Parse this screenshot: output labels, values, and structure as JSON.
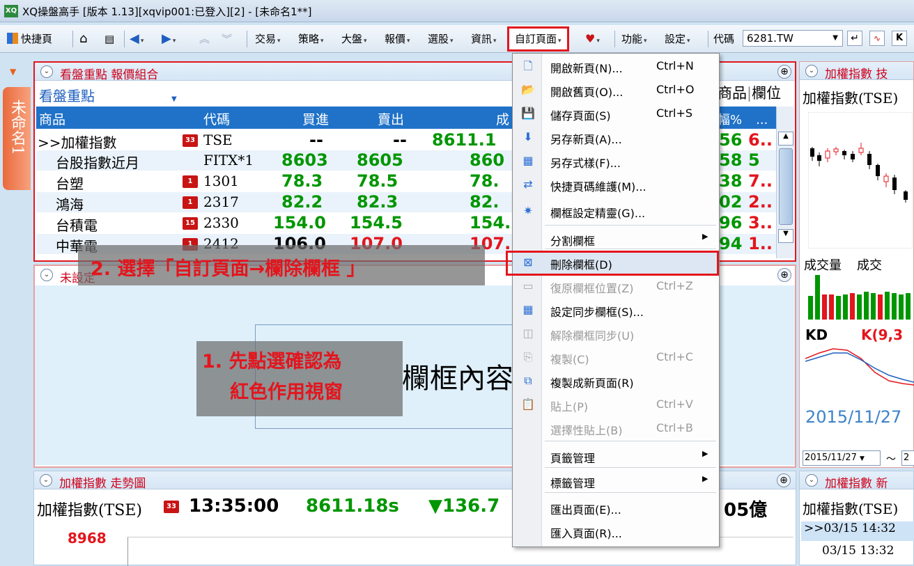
{
  "window": {
    "title": "XQ操盤高手 [版本 1.13][xqvip001:已登入][2] - [未命名1**]",
    "icon_text": "XQ"
  },
  "toolbar": {
    "quick_page": "快捷頁",
    "menus": [
      "交易",
      "策略",
      "大盤",
      "報價",
      "選股",
      "資訊"
    ],
    "custom_page": "自訂頁面",
    "function": "功能",
    "settings": "設定",
    "code_label": "代碼",
    "code_value": "6281.TW"
  },
  "side_tab": {
    "label": "未命名1"
  },
  "panel_quote": {
    "title": "看盤重點 報價組合",
    "group": "看盤重點",
    "headers": [
      "商品",
      "代碼",
      "買進",
      "賣出",
      "成"
    ],
    "rows": [
      {
        "name": ">>加權指數",
        "badge": "33",
        "code": "TSE",
        "bid": "--",
        "ask": "--",
        "last": "8611.1"
      },
      {
        "name": "台股指數近月",
        "badge": "",
        "code": "FITX*1",
        "bid": "8603",
        "ask": "8605",
        "last": "860"
      },
      {
        "name": "台塑",
        "badge": "1",
        "code": "1301",
        "bid": "78.3",
        "ask": "78.5",
        "last": "78."
      },
      {
        "name": "鴻海",
        "badge": "1",
        "code": "2317",
        "bid": "82.2",
        "ask": "82.3",
        "last": "82."
      },
      {
        "name": "台積電",
        "badge": "15",
        "code": "2330",
        "bid": "154.0",
        "ask": "154.5",
        "last": "154."
      },
      {
        "name": "中華電",
        "badge": "1",
        "code": "2412",
        "bid": "106.0",
        "ask": "107.0",
        "last": "107."
      }
    ],
    "right_headers": [
      "商品",
      "欄位"
    ],
    "right_sub": "幅%",
    "right_sub2": "...",
    "right_vals": [
      {
        "a": "56",
        "b": "6.."
      },
      {
        "a": "58",
        "b": "5"
      },
      {
        "a": "38",
        "b": "7.."
      },
      {
        "a": "02",
        "b": "2.."
      },
      {
        "a": "96",
        "b": "3.."
      },
      {
        "a": "94",
        "b": "1.."
      }
    ]
  },
  "panel_unset": {
    "title": "未設定",
    "content": "欄框內容"
  },
  "panel_trend": {
    "title": "加權指數 走勢圖",
    "name": "加權指數(TSE)",
    "badge": "33",
    "time": "13:35:00",
    "price": "8611.18s",
    "change": "▼136.7",
    "volume_tail": "05億",
    "y_label": "8968"
  },
  "panel_tech": {
    "title": "加權指數 技",
    "name": "加權指數(TSE)",
    "vol_label": "成交量",
    "vol_label2": "成交",
    "kd_label": "KD",
    "kd_value": "K(9,3",
    "date": "2015/11/27",
    "date_sel": "2015/11/27",
    "date_tilde": "～",
    "date_sel2": "2"
  },
  "panel_news": {
    "title": "加權指數 新",
    "name": "加權指數(TSE)",
    "items": [
      ">>03/15 14:32",
      "03/15 13:32"
    ]
  },
  "menu": {
    "items": [
      {
        "icon": "new-page-icon",
        "label": "開啟新頁(N)...",
        "shortcut": "Ctrl+N",
        "enabled": true
      },
      {
        "icon": "open-folder-icon",
        "label": "開啟舊頁(O)...",
        "shortcut": "Ctrl+O",
        "enabled": true
      },
      {
        "icon": "save-icon",
        "label": "儲存頁面(S)",
        "shortcut": "Ctrl+S",
        "enabled": true
      },
      {
        "icon": "save-new-icon",
        "label": "另存新頁(A)...",
        "shortcut": "",
        "enabled": true
      },
      {
        "icon": "save-style-icon",
        "label": "另存式樣(F)...",
        "shortcut": "",
        "enabled": true
      },
      {
        "icon": "shortcut-maintain-icon",
        "label": "快捷頁碼維護(M)...",
        "shortcut": "",
        "enabled": true
      },
      {
        "icon": "wizard-icon",
        "label": "欄框設定精靈(G)...",
        "shortcut": "",
        "enabled": true
      },
      {
        "icon": "",
        "label": "分割欄框",
        "shortcut": "",
        "enabled": true,
        "submenu": true
      },
      {
        "icon": "delete-frame-icon",
        "label": "刪除欄框(D)",
        "shortcut": "",
        "enabled": true
      },
      {
        "icon": "restore-frame-icon",
        "label": "復原欄框位置(Z)",
        "shortcut": "Ctrl+Z",
        "enabled": false
      },
      {
        "icon": "sync-frame-icon",
        "label": "設定同步欄框(S)...",
        "shortcut": "",
        "enabled": true
      },
      {
        "icon": "unsync-frame-icon",
        "label": "解除欄框同步(U)",
        "shortcut": "",
        "enabled": false
      },
      {
        "icon": "copy-icon",
        "label": "複製(C)",
        "shortcut": "Ctrl+C",
        "enabled": false
      },
      {
        "icon": "copy-new-page-icon",
        "label": "複製成新頁面(R)",
        "shortcut": "",
        "enabled": true
      },
      {
        "icon": "paste-icon",
        "label": "貼上(P)",
        "shortcut": "Ctrl+V",
        "enabled": false
      },
      {
        "icon": "",
        "label": "選擇性貼上(B)",
        "shortcut": "Ctrl+B",
        "enabled": false
      },
      {
        "icon": "",
        "label": "頁籤管理",
        "shortcut": "",
        "enabled": true,
        "submenu": true
      },
      {
        "icon": "",
        "label": "標籤管理",
        "shortcut": "",
        "enabled": true,
        "submenu": true
      },
      {
        "icon": "",
        "label": "匯出頁面(E)...",
        "shortcut": "",
        "enabled": true
      },
      {
        "icon": "",
        "label": "匯入頁面(R)...",
        "shortcut": "",
        "enabled": true
      }
    ]
  },
  "annotations": {
    "step2": "2. 選擇「自訂頁面→欄除欄框 」",
    "step1_line1": "1. 先點選確認為",
    "step1_line2": "紅色作用視窗"
  },
  "colors": {
    "accent_red": "#e3151d",
    "header_blue": "#1f72c8",
    "up_green": "#009600"
  }
}
